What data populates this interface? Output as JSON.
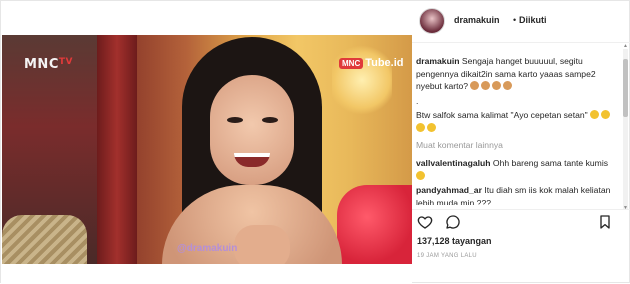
{
  "video": {
    "channel_logo": "MNC",
    "channel_logo_suffix": "TV",
    "partner_logo": "Tube.id",
    "partner_logo_mark": "MNC",
    "watermark_handle": "@dramakuin"
  },
  "header": {
    "username": "dramakuin",
    "separator": "•",
    "follow_status": "Diikuti"
  },
  "comments": {
    "caption": {
      "username": "dramakuin",
      "text": "Sengaja hanget buuuuul, segitu pengennya dikait2in sama karto yaaas sampe2 nyebut karto?",
      "dot": ".",
      "line2": "Btw salfok sama kalimat \"Ayo cepetan setan\""
    },
    "load_more": "Muat komentar lainnya",
    "items": [
      {
        "username": "vallvalentinagaluh",
        "text": "Ohh bareng sama tante kumis"
      },
      {
        "username": "pandyahmad_ar",
        "text": "Itu diah sm iis kok malah keliatan lebih muda min ???"
      }
    ]
  },
  "actions": {
    "like_icon": "heart-icon",
    "comment_icon": "comment-icon",
    "save_icon": "bookmark-icon"
  },
  "stats": {
    "views": "137,128 tayangan",
    "timestamp": "19 JAM YANG LALU"
  },
  "colors": {
    "text": "#262626",
    "muted": "#999999",
    "border": "#efefef"
  }
}
